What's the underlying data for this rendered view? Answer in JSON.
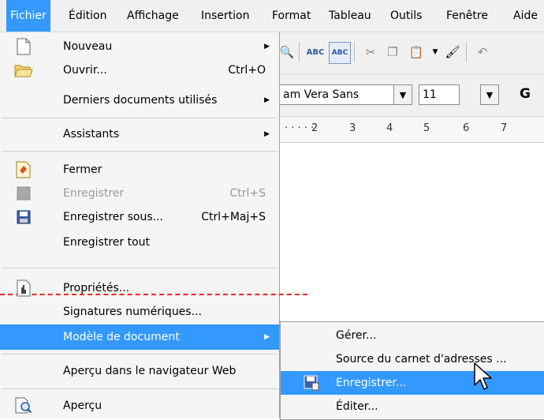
{
  "menubar": [
    "Fichier",
    "Édition",
    "Affichage",
    "Insertion",
    "Format",
    "Tableau",
    "Outils",
    "Fenêtre",
    "Aide"
  ],
  "toolbar": {
    "font_name": "am Vera Sans",
    "font_size": "11",
    "bold_label": "G",
    "ruler_numbers": [
      "2",
      "3",
      "4",
      "5",
      "6",
      "7"
    ]
  },
  "menu": {
    "nouveau": {
      "label": "Nouveau"
    },
    "ouvrir": {
      "label": "Ouvrir...",
      "shortcut": "Ctrl+O"
    },
    "recent": {
      "label": "Derniers documents utilisés"
    },
    "assistants": {
      "label": "Assistants"
    },
    "fermer": {
      "label": "Fermer"
    },
    "enregistrer": {
      "label": "Enregistrer",
      "shortcut": "Ctrl+S"
    },
    "enregistrer_sous": {
      "label": "Enregistrer sous...",
      "shortcut": "Ctrl+Maj+S"
    },
    "enregistrer_tout": {
      "label": "Enregistrer tout"
    },
    "proprietes": {
      "label": "Propriétés..."
    },
    "signatures": {
      "label": "Signatures numériques..."
    },
    "modele": {
      "label": "Modèle de document"
    },
    "apercu_web": {
      "label": "Aperçu dans le navigateur Web"
    },
    "apercu": {
      "label": "Aperçu"
    }
  },
  "submenu": {
    "gerer": "Gérer...",
    "source": "Source du carnet d'adresses ...",
    "enregistrer": "Enregistrer...",
    "editer": "Éditer..."
  },
  "colors": {
    "highlight": "#3399ff",
    "tear_line": "#e8262c",
    "menu_bg": "#f5f5f5"
  }
}
